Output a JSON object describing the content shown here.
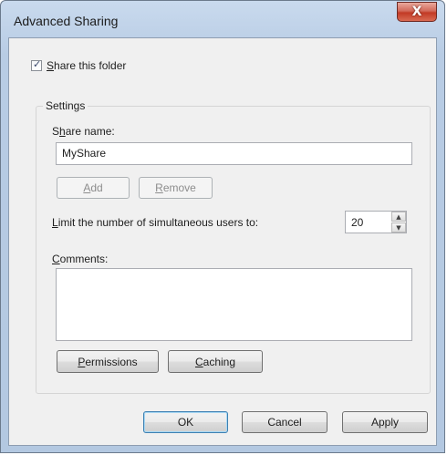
{
  "window": {
    "title": "Advanced Sharing",
    "close_glyph": "X"
  },
  "share_checkbox": {
    "label_prefix": "",
    "label_mnemonic": "S",
    "label_rest": "hare this folder",
    "checked": true
  },
  "settings": {
    "legend": "Settings",
    "share_name_label_pre": "S",
    "share_name_label_mnemonic": "h",
    "share_name_label_rest": "are name:",
    "share_name_value": "MyShare",
    "add_mnemonic": "A",
    "add_rest": "dd",
    "remove_mnemonic": "R",
    "remove_rest": "emove",
    "limit_mnemonic": "L",
    "limit_rest": "imit the number of simultaneous users to:",
    "limit_value": "20",
    "comments_pre": "",
    "comments_mnemonic": "C",
    "comments_rest": "omments:",
    "comments_value": "",
    "permissions_mnemonic": "P",
    "permissions_rest": "ermissions",
    "caching_mnemonic": "C",
    "caching_rest": "aching"
  },
  "footer": {
    "ok_label": "OK",
    "cancel_label": "Cancel",
    "apply_label": "Apply"
  },
  "icons": {
    "close": "close-icon",
    "spin_up": "spin-up-icon",
    "spin_down": "spin-down-icon"
  }
}
